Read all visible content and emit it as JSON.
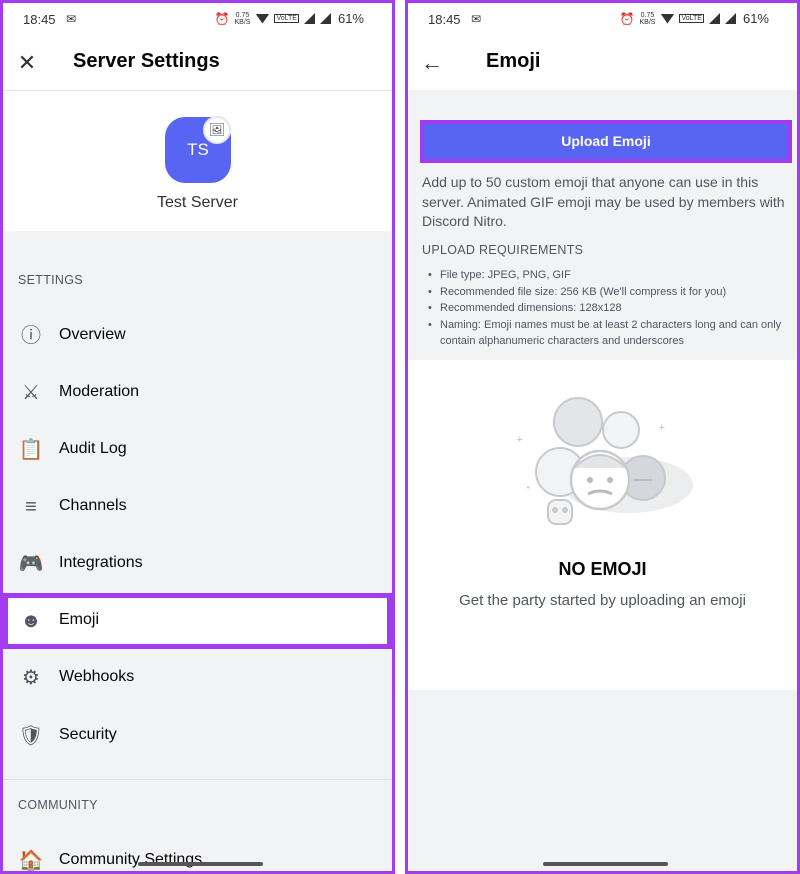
{
  "status_bar": {
    "time": "18:45",
    "speed_top": "0.75",
    "speed_unit": "KB/S",
    "volte": "VoLTE",
    "battery": "61%"
  },
  "left": {
    "app_bar": {
      "title": "Server Settings"
    },
    "profile": {
      "initials": "TS",
      "name": "Test Server"
    },
    "sections": {
      "settings_heading": "SETTINGS",
      "community_heading": "COMMUNITY"
    },
    "menu": [
      {
        "label": "Overview",
        "icon": "info-icon"
      },
      {
        "label": "Moderation",
        "icon": "swords-icon"
      },
      {
        "label": "Audit Log",
        "icon": "clipboard-icon"
      },
      {
        "label": "Channels",
        "icon": "list-icon"
      },
      {
        "label": "Integrations",
        "icon": "gamepad-icon"
      },
      {
        "label": "Emoji",
        "icon": "emoji-icon",
        "selected": true
      },
      {
        "label": "Webhooks",
        "icon": "webhook-icon"
      },
      {
        "label": "Security",
        "icon": "shield-server-icon"
      },
      {
        "label": "Community Settings",
        "icon": "community-icon"
      }
    ]
  },
  "right": {
    "app_bar": {
      "title": "Emoji"
    },
    "upload_button": "Upload Emoji",
    "description": "Add up to 50 custom emoji that anyone can use in this server. Animated GIF emoji may be used by members with Discord Nitro.",
    "requirements_heading": "UPLOAD REQUIREMENTS",
    "requirements": [
      "File type: JPEG, PNG, GIF",
      "Recommended file size: 256 KB (We'll compress it for you)",
      "Recommended dimensions: 128x128",
      "Naming: Emoji names must be at least 2 characters long and can only contain alphanumeric characters and underscores"
    ],
    "empty_title": "NO EMOJI",
    "empty_subtitle": "Get the party started by uploading an emoji"
  },
  "colors": {
    "accent_highlight": "#a33cf0",
    "blurple": "#5865f2",
    "background": "#f2f3f5"
  }
}
